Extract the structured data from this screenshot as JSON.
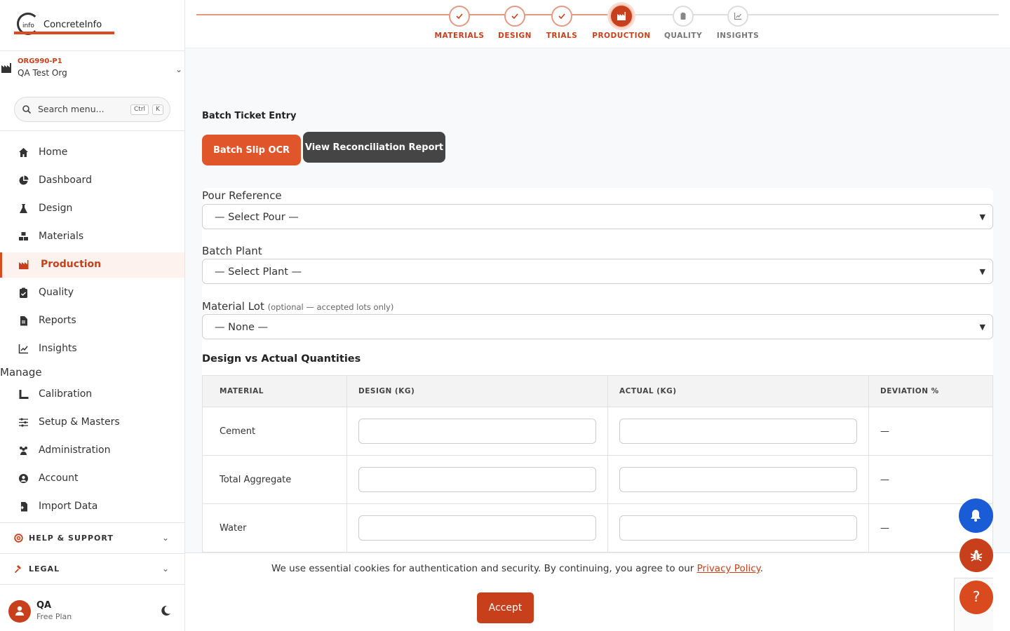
{
  "brand": {
    "logo_mark": "info",
    "name": "ConcreteInfo"
  },
  "org": {
    "code": "ORG990-P1",
    "name": "QA Test Org"
  },
  "search": {
    "placeholder": "Search menu...",
    "key1": "Ctrl",
    "key2": "K"
  },
  "nav": {
    "home": "Home",
    "dashboard": "Dashboard",
    "design": "Design",
    "materials": "Materials",
    "production": "Production",
    "quality": "Quality",
    "reports": "Reports",
    "insights": "Insights",
    "manage_heading": "Manage",
    "calibration": "Calibration",
    "setup": "Setup & Masters",
    "administration": "Administration",
    "account": "Account",
    "import": "Import Data"
  },
  "sections": {
    "help": "HELP & SUPPORT",
    "legal": "LEGAL"
  },
  "user": {
    "name": "QA",
    "plan": "Free Plan"
  },
  "stepper": {
    "materials": "MATERIALS",
    "design": "DESIGN",
    "trials": "TRIALS",
    "production": "PRODUCTION",
    "quality": "QUALITY",
    "insights": "INSIGHTS"
  },
  "page": {
    "title": "Batch Ticket Entry",
    "btn_ocr": "Batch Slip OCR",
    "btn_report": "View Reconciliation Report"
  },
  "form": {
    "pour_label": "Pour Reference",
    "pour_value": "— Select Pour —",
    "plant_label": "Batch Plant",
    "plant_value": "— Select Plant —",
    "lot_label": "Material Lot",
    "lot_hint": "(optional — accepted lots only)",
    "lot_value": "— None —"
  },
  "table": {
    "heading": "Design vs Actual Quantities",
    "headers": {
      "material": "MATERIAL",
      "design": "DESIGN (KG)",
      "actual": "ACTUAL (KG)",
      "deviation": "DEVIATION %"
    },
    "rows": [
      {
        "material": "Cement",
        "deviation": "—"
      },
      {
        "material": "Total Aggregate",
        "deviation": "—"
      },
      {
        "material": "Water",
        "deviation": "—"
      }
    ]
  },
  "cookie": {
    "message": "We use essential cookies for authentication and security. By continuing, you agree to our",
    "link": "Privacy Policy",
    "period": ".",
    "accept": "Accept"
  },
  "fabs": {
    "help": "?"
  },
  "colors": {
    "accent": "#c8401b",
    "accent_light": "#e0552a",
    "bell": "#1a5bd6",
    "dark_button": "#454545"
  }
}
